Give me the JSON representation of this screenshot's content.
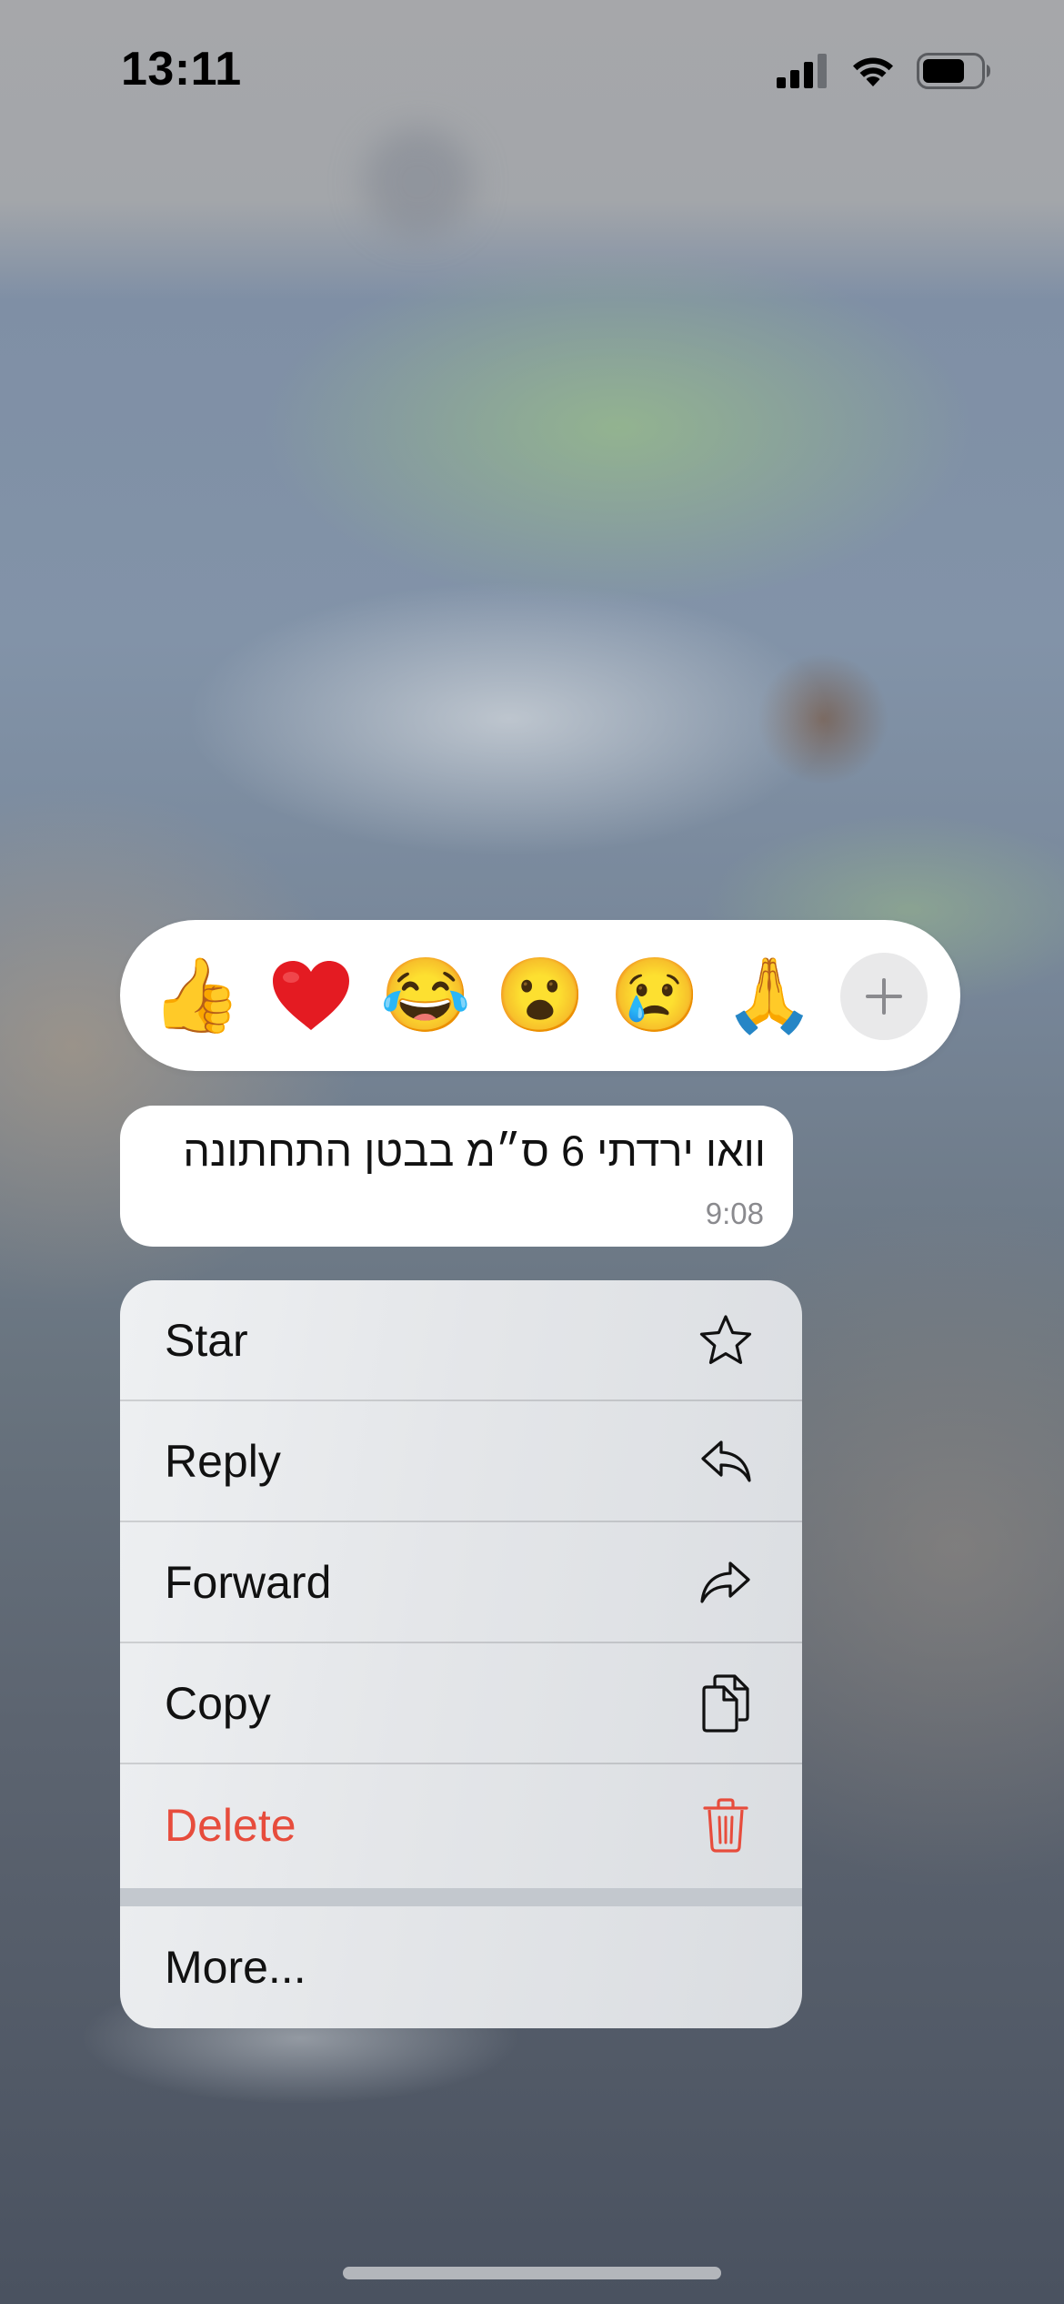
{
  "status_bar": {
    "time": "13:11",
    "icons": [
      "cellular-signal-icon",
      "wifi-icon",
      "battery-icon"
    ]
  },
  "reactions": {
    "emojis": [
      "👍",
      "❤️",
      "😂",
      "😮",
      "😢",
      "🙏"
    ],
    "more_icon": "plus-icon"
  },
  "message": {
    "text": "וואו ירדתי 6 ס״מ בבטן התחתונה",
    "time": "9:08"
  },
  "menu": {
    "star": "Star",
    "reply": "Reply",
    "forward": "Forward",
    "copy": "Copy",
    "delete": "Delete",
    "more": "More...",
    "danger_color": "#e74c3c"
  }
}
